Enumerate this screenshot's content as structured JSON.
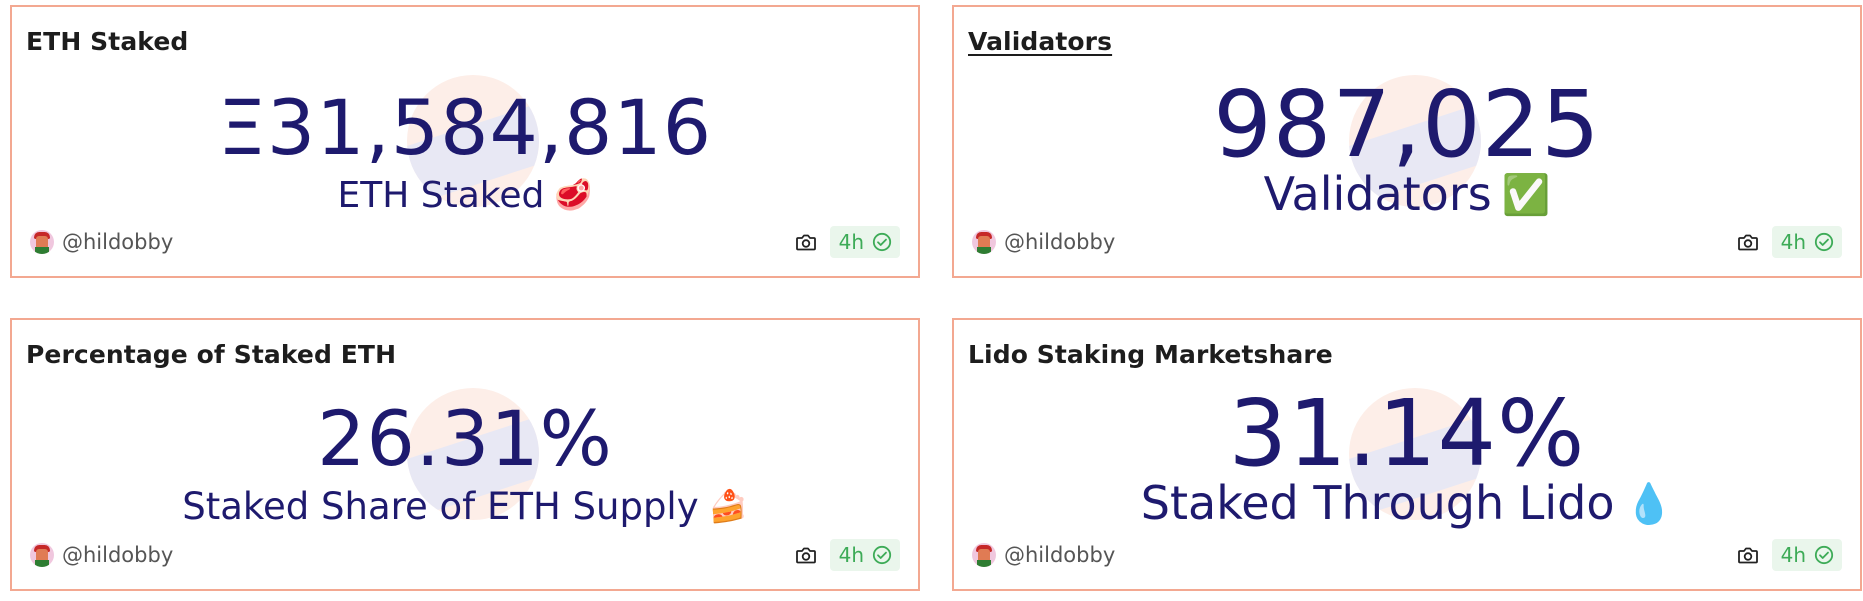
{
  "colors": {
    "border": "#f3a891",
    "value_text": "#1e1a6e",
    "badge_bg": "#eaf6ec",
    "badge_text": "#3dab57"
  },
  "cards": [
    {
      "title": "ETH Staked",
      "title_is_link": false,
      "value": "Ξ31,584,816",
      "subtitle": "ETH Staked",
      "emoji": "🥩",
      "author": "@hildobby",
      "freshness": "4h"
    },
    {
      "title": "Validators",
      "title_is_link": true,
      "value": "987,025",
      "subtitle": "Validators",
      "emoji": "✅",
      "author": "@hildobby",
      "freshness": "4h"
    },
    {
      "title": "Percentage of Staked ETH",
      "title_is_link": false,
      "value": "26.31%",
      "subtitle": "Staked Share of ETH Supply",
      "emoji": "🍰",
      "author": "@hildobby",
      "freshness": "4h"
    },
    {
      "title": "Lido Staking Marketshare",
      "title_is_link": false,
      "value": "31.14%",
      "subtitle": "Staked Through Lido",
      "emoji": "💧",
      "author": "@hildobby",
      "freshness": "4h"
    }
  ],
  "icons": {
    "camera": "camera-icon",
    "check": "check-circle-icon",
    "avatar": "avatar-icon"
  }
}
